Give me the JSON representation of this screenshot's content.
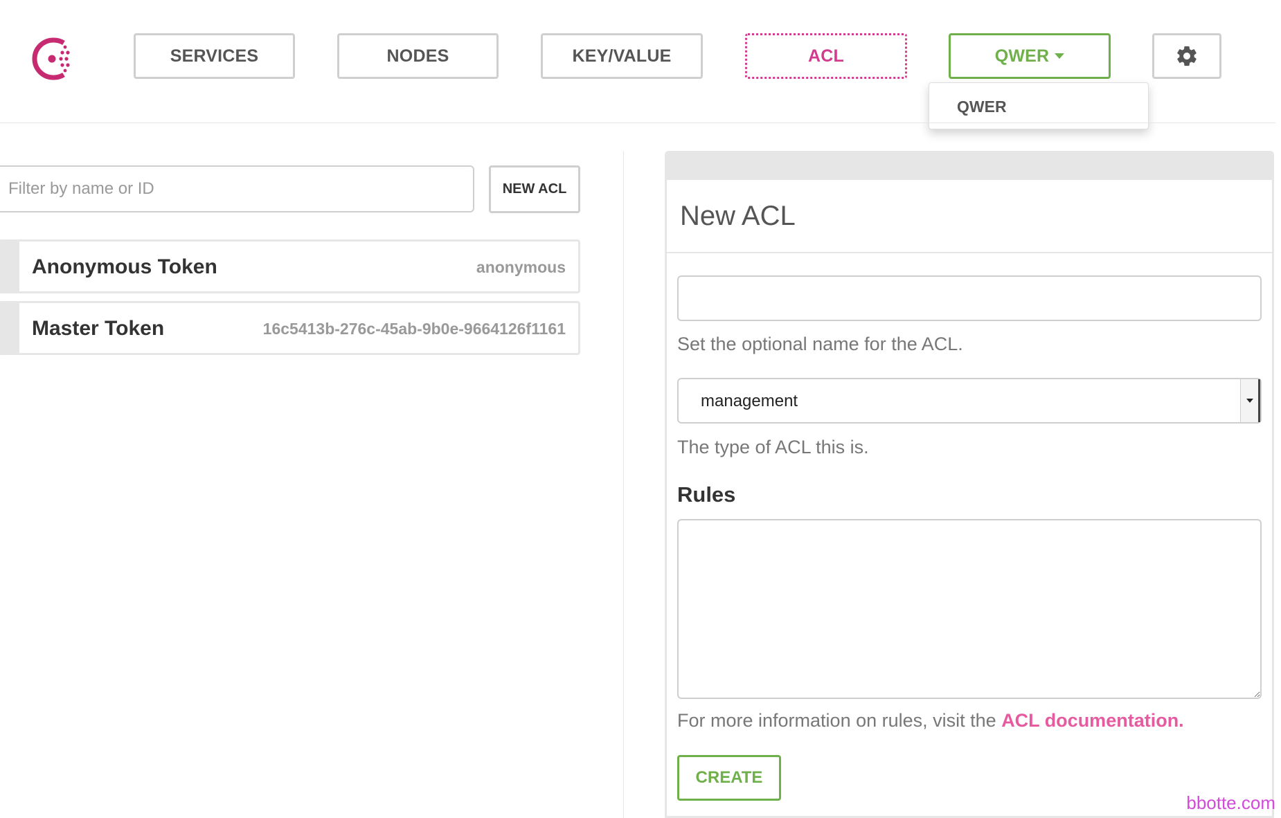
{
  "nav": {
    "services": "SERVICES",
    "nodes": "NODES",
    "key_value": "KEY/VALUE",
    "acl": "ACL",
    "datacenter": "QWER",
    "settings_icon": "gear-icon",
    "logo_icon": "consul-logo",
    "active_color": "#d33b8f",
    "dc_color": "#6fb04b"
  },
  "dc_dropdown": {
    "items": [
      "QWER"
    ]
  },
  "filter": {
    "placeholder": "Filter by name or ID",
    "value": ""
  },
  "new_acl_button": "NEW ACL",
  "tokens": [
    {
      "name": "Anonymous Token",
      "id": "anonymous"
    },
    {
      "name": "Master Token",
      "id": "16c5413b-276c-45ab-9b0e-9664126f1161"
    }
  ],
  "form": {
    "title": "New ACL",
    "name_value": "",
    "name_help": "Set the optional name for the ACL.",
    "type_value": "management",
    "type_help": "The type of ACL this is.",
    "rules_label": "Rules",
    "rules_value": "",
    "rules_help_prefix": "For more information on rules, visit the ",
    "rules_help_link": "ACL documentation.",
    "create_button": "CREATE"
  },
  "watermark": "bbotte.com"
}
